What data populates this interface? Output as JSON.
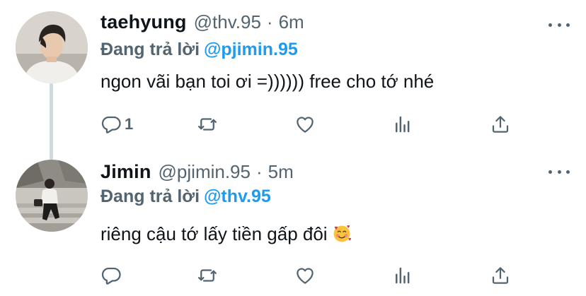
{
  "tweets": [
    {
      "display_name": "taehyung",
      "handle": "@thv.95",
      "separator": "·",
      "time": "6m",
      "reply_prefix": "Đang trả lời",
      "reply_to": "@pjimin.95",
      "text": "ngon vãi bạn toi ơi =)))))) free cho tớ nhé",
      "reply_count": "1",
      "avatar": "avatar-taehyung"
    },
    {
      "display_name": "Jimin",
      "handle": "@pjimin.95",
      "separator": "·",
      "time": "5m",
      "reply_prefix": "Đang trả lời",
      "reply_to": "@thv.95",
      "text": "riêng cậu tớ lấy tiền gấp đôi",
      "emoji": "smiling-face-with-hearts",
      "reply_count": "",
      "avatar": "avatar-jimin"
    }
  ],
  "icons": {
    "reply": "reply-icon",
    "retweet": "retweet-icon",
    "like": "like-icon",
    "views": "views-icon",
    "share": "share-icon",
    "more": "more-icon"
  },
  "colors": {
    "mention": "#1d9bf0",
    "secondary_text": "#536471",
    "thread_line": "#cfd9de"
  }
}
